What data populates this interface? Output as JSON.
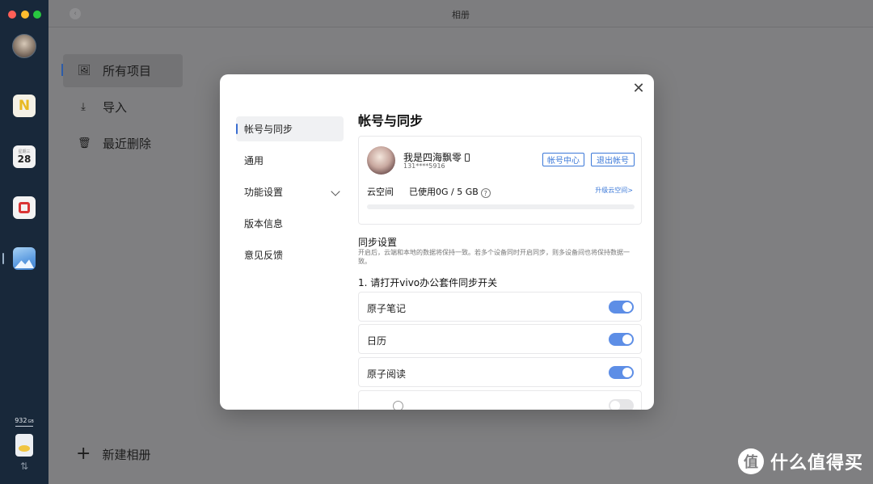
{
  "window": {
    "title": "相册"
  },
  "dock": {
    "calendar_weekday": "星期三",
    "calendar_day": "28",
    "notes_letter": "N",
    "storage": "932",
    "storage_unit": "GB",
    "sync_arrows": "⇅"
  },
  "sidebar": {
    "items": [
      {
        "label": "所有项目",
        "icon": "image-icon"
      },
      {
        "label": "导入",
        "icon": "download-icon"
      },
      {
        "label": "最近删除",
        "icon": "trash-icon"
      }
    ],
    "new_album": "新建相册"
  },
  "modal": {
    "close": "✕",
    "nav": [
      {
        "label": "帐号与同步"
      },
      {
        "label": "通用"
      },
      {
        "label": "功能设置"
      },
      {
        "label": "版本信息"
      },
      {
        "label": "意见反馈"
      }
    ],
    "heading": "帐号与同步",
    "account": {
      "name": "我是四海飘零",
      "phone": "131****5916",
      "account_center": "帐号中心",
      "logout": "退出帐号"
    },
    "cloud": {
      "label": "云空间",
      "used": "已使用0G / 5 GB",
      "help": "?",
      "upgrade": "升级云空间>",
      "used_fraction": 0.0
    },
    "sync": {
      "title": "同步设置",
      "description": "开启后，云端和本地的数据将保持一致。若多个设备同时开启同步，则多设备间也将保持数据一致。",
      "step1": "1. 请打开vivo办公套件同步开关",
      "toggles": [
        {
          "label": "原子笔记",
          "on": true
        },
        {
          "label": "日历",
          "on": true
        },
        {
          "label": "原子阅读",
          "on": true
        },
        {
          "label": "",
          "on": false
        }
      ]
    }
  },
  "watermark": {
    "logo": "值",
    "text": "什么值得买"
  },
  "colors": {
    "accent": "#3b78d8",
    "switch_on": "#5d8ee6",
    "dock_bg": "#18283a"
  }
}
